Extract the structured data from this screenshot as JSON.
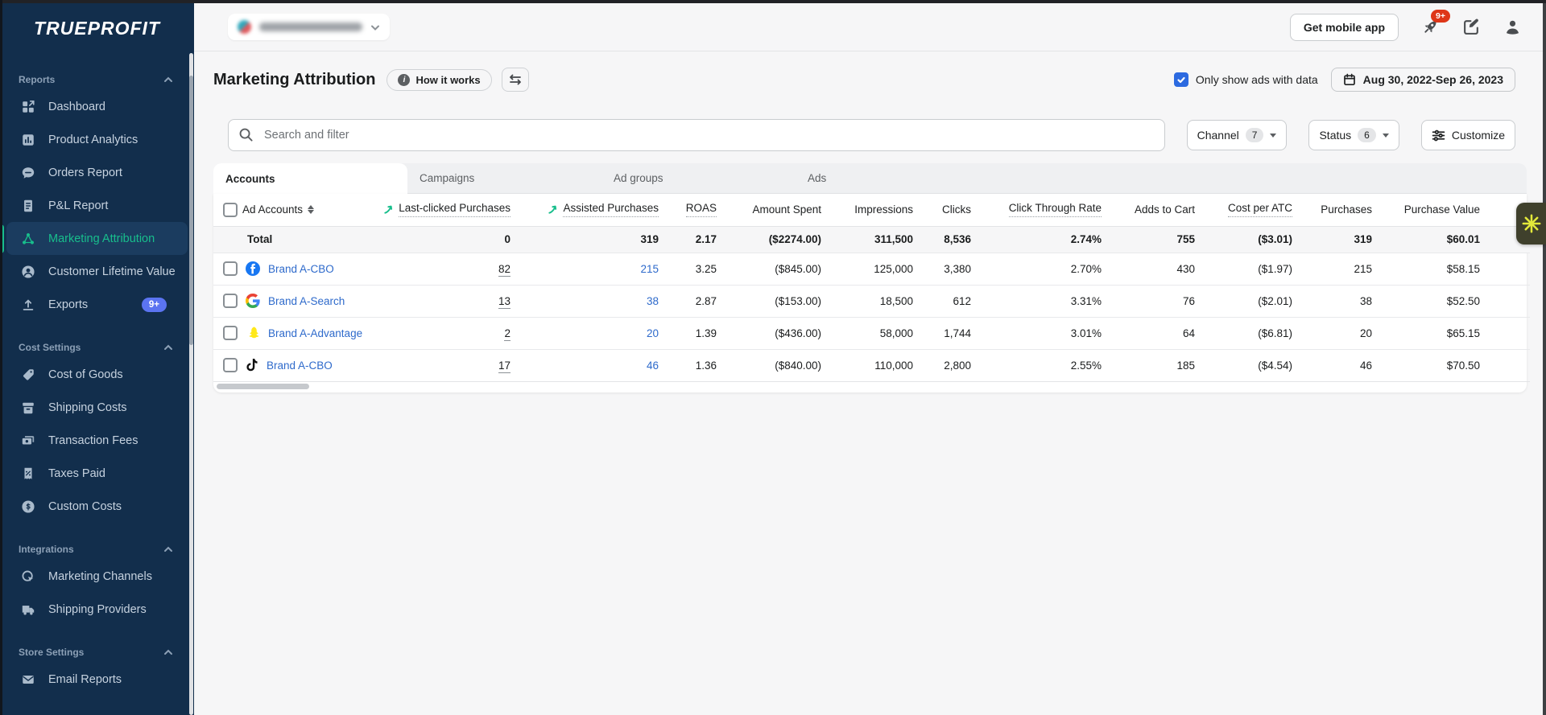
{
  "topbar": {
    "get_mobile_app_label": "Get mobile app",
    "notifications_badge": "9+",
    "icons": [
      "rocket-icon",
      "changelog-icon",
      "account-icon"
    ]
  },
  "sidebar": {
    "logo_text": "TRUEPROFIT",
    "sections": [
      {
        "label": "Reports",
        "items": [
          {
            "label": "Dashboard",
            "icon": "dashboard-icon"
          },
          {
            "label": "Product Analytics",
            "icon": "bar-chart-icon"
          },
          {
            "label": "Orders Report",
            "icon": "chat-bubble-icon"
          },
          {
            "label": "P&L Report",
            "icon": "document-icon"
          },
          {
            "label": "Marketing Attribution",
            "icon": "share-nodes-icon",
            "active": true
          },
          {
            "label": "Customer Lifetime Value",
            "icon": "person-circle-icon"
          },
          {
            "label": "Exports",
            "icon": "upload-icon",
            "badge": "9+"
          }
        ]
      },
      {
        "label": "Cost Settings",
        "items": [
          {
            "label": "Cost of Goods",
            "icon": "tag-icon"
          },
          {
            "label": "Shipping Costs",
            "icon": "archive-box-icon"
          },
          {
            "label": "Transaction Fees",
            "icon": "cash-icon"
          },
          {
            "label": "Taxes Paid",
            "icon": "receipt-icon"
          },
          {
            "label": "Custom Costs",
            "icon": "dollar-circle-icon"
          }
        ]
      },
      {
        "label": "Integrations",
        "items": [
          {
            "label": "Marketing Channels",
            "icon": "target-click-icon"
          },
          {
            "label": "Shipping Providers",
            "icon": "truck-icon"
          }
        ]
      },
      {
        "label": "Store Settings",
        "items": [
          {
            "label": "Email Reports",
            "icon": "envelope-icon"
          }
        ]
      }
    ]
  },
  "header": {
    "title": "Marketing Attribution",
    "how_it_works_label": "How it works",
    "only_show_label": "Only show ads with data",
    "date_range_label": "Aug 30, 2022-Sep 26, 2023"
  },
  "filters": {
    "search_placeholder": "Search and filter",
    "channel_label": "Channel",
    "channel_count": "7",
    "status_label": "Status",
    "status_count": "6",
    "customize_label": "Customize"
  },
  "tabs": [
    {
      "label": "Accounts",
      "active": true
    },
    {
      "label": "Campaigns"
    },
    {
      "label": "Ad groups"
    },
    {
      "label": "Ads"
    }
  ],
  "table": {
    "columns": [
      "Ad Accounts",
      "Last-clicked Purchases",
      "Assisted Purchases",
      "ROAS",
      "Amount Spent",
      "Impressions",
      "Clicks",
      "Click Through Rate",
      "Adds to Cart",
      "Cost per ATC",
      "Purchases",
      "Purchase Value"
    ],
    "total_label": "Total",
    "total": {
      "last_clicked": "0",
      "assisted": "319",
      "roas": "2.17",
      "amount_spent": "($2274.00)",
      "impressions": "311,500",
      "clicks": "8,536",
      "ctr": "2.74%",
      "atc": "755",
      "cost_per_atc": "($3.01)",
      "purchases": "319",
      "purchase_value": "$60.01"
    },
    "rows": [
      {
        "platform": "facebook",
        "name": "Brand A-CBO",
        "last_clicked": "82",
        "assisted": "215",
        "roas": "3.25",
        "amount_spent": "($845.00)",
        "impressions": "125,000",
        "clicks": "3,380",
        "ctr": "2.70%",
        "atc": "430",
        "cost_per_atc": "($1.97)",
        "purchases": "215",
        "purchase_value": "$58.15"
      },
      {
        "platform": "google",
        "name": "Brand A-Search",
        "last_clicked": "13",
        "assisted": "38",
        "roas": "2.87",
        "amount_spent": "($153.00)",
        "impressions": "18,500",
        "clicks": "612",
        "ctr": "3.31%",
        "atc": "76",
        "cost_per_atc": "($2.01)",
        "purchases": "38",
        "purchase_value": "$52.50"
      },
      {
        "platform": "snapchat",
        "name": "Brand A-Advantage",
        "last_clicked": "2",
        "assisted": "20",
        "roas": "1.39",
        "amount_spent": "($436.00)",
        "impressions": "58,000",
        "clicks": "1,744",
        "ctr": "3.01%",
        "atc": "64",
        "cost_per_atc": "($6.81)",
        "purchases": "20",
        "purchase_value": "$65.15"
      },
      {
        "platform": "tiktok",
        "name": "Brand A-CBO",
        "last_clicked": "17",
        "assisted": "46",
        "roas": "1.36",
        "amount_spent": "($840.00)",
        "impressions": "110,000",
        "clicks": "2,800",
        "ctr": "2.55%",
        "atc": "185",
        "cost_per_atc": "($4.54)",
        "purchases": "46",
        "purchase_value": "$70.50"
      }
    ]
  }
}
